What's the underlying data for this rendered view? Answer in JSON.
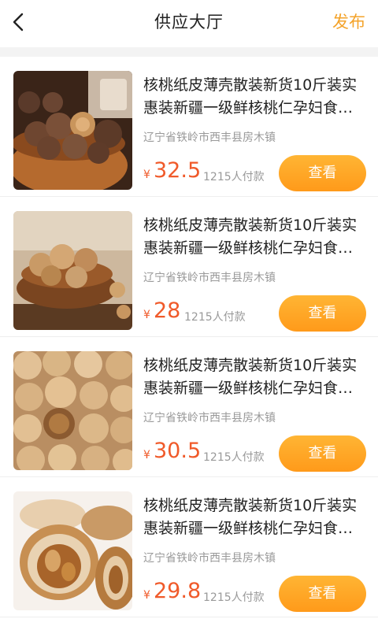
{
  "nav": {
    "title": "供应大厅",
    "action": "发布"
  },
  "products": [
    {
      "title": "核桃纸皮薄壳散装新货10斤装实惠装新疆一级鲜核桃仁孕妇食…",
      "location": "辽宁省铁岭市西丰县房木镇",
      "currency": "¥",
      "price": "32.5",
      "buyers": "1215人付款",
      "button": "查看"
    },
    {
      "title": "核桃纸皮薄壳散装新货10斤装实惠装新疆一级鲜核桃仁孕妇食…",
      "location": "辽宁省铁岭市西丰县房木镇",
      "currency": "¥",
      "price": "28",
      "buyers": "1215人付款",
      "button": "查看"
    },
    {
      "title": "核桃纸皮薄壳散装新货10斤装实惠装新疆一级鲜核桃仁孕妇食…",
      "location": "辽宁省铁岭市西丰县房木镇",
      "currency": "¥",
      "price": "30.5",
      "buyers": "1215人付款",
      "button": "查看"
    },
    {
      "title": "核桃纸皮薄壳散装新货10斤装实惠装新疆一级鲜核桃仁孕妇食…",
      "location": "辽宁省铁岭市西丰县房木镇",
      "currency": "¥",
      "price": "29.8",
      "buyers": "1215人付款",
      "button": "查看"
    }
  ],
  "colors": {
    "accent": "#f4a32a",
    "price": "#f05a2a",
    "button_top": "#ffb534",
    "button_bottom": "#ff9a1a"
  },
  "icons": {
    "back": "chevron-left-icon"
  }
}
